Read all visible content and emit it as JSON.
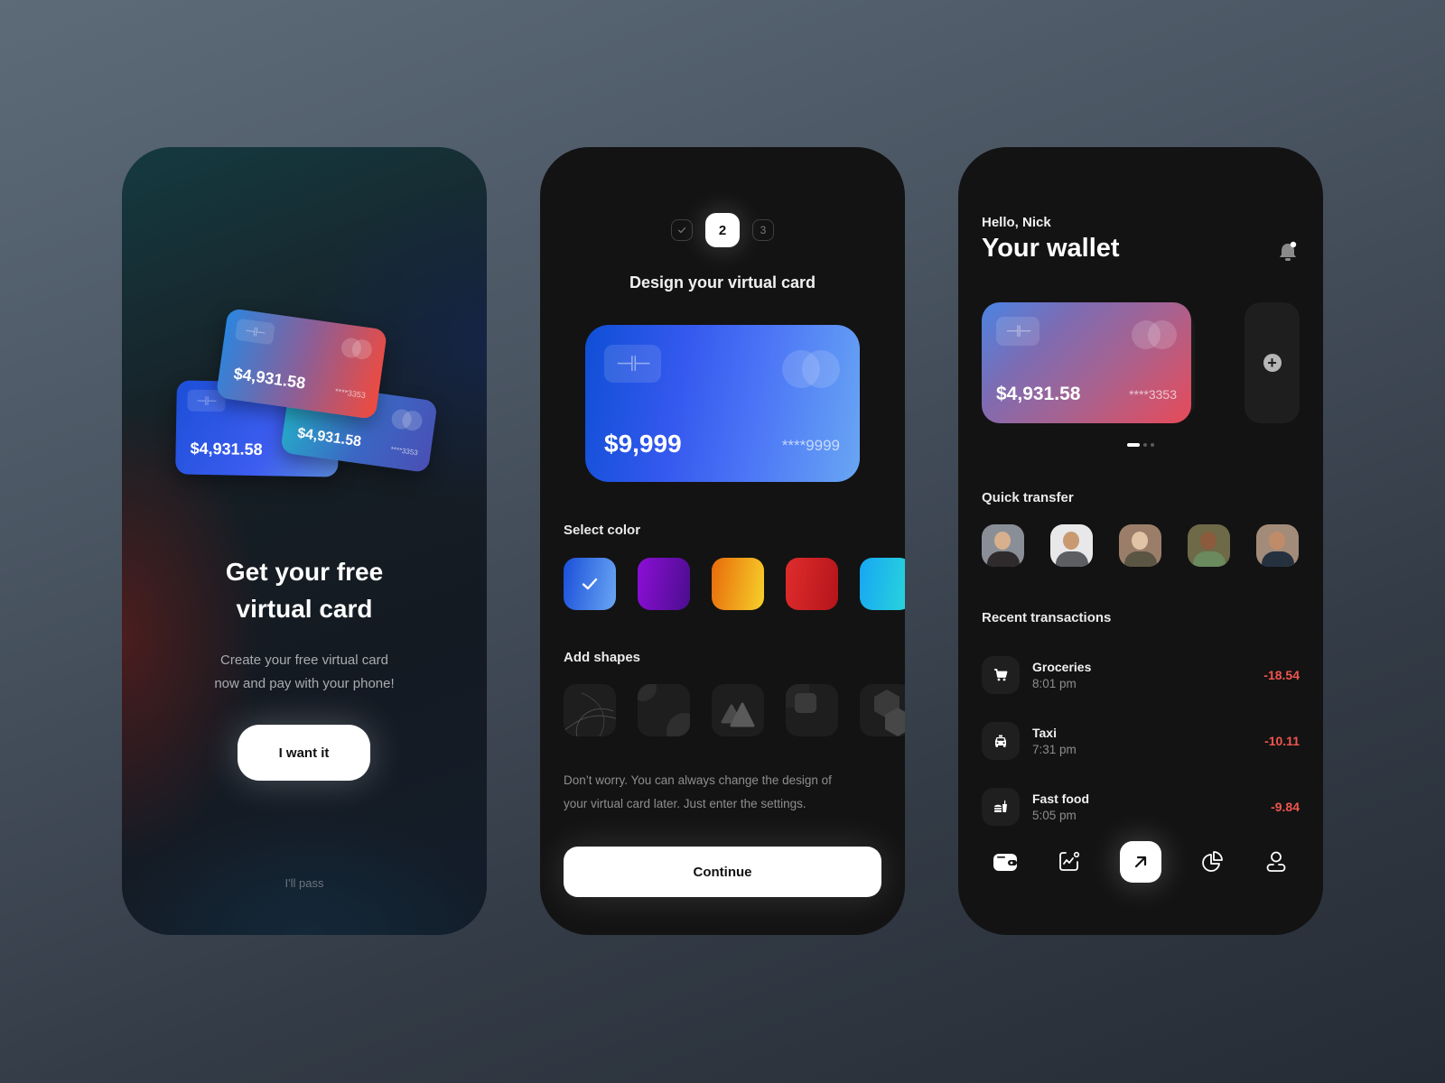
{
  "onboarding": {
    "cards": [
      {
        "amount": "$4,931.58",
        "number": "****3353"
      },
      {
        "amount": "$4,931.58",
        "number": "****3353"
      },
      {
        "amount": "$4,931.58",
        "number": ""
      }
    ],
    "title_line1": "Get your free",
    "title_line2": "virtual card",
    "subtitle_line1": "Create your free virtual card",
    "subtitle_line2": "now and pay with your phone!",
    "primary_button": "I want it",
    "secondary_link": "I'll pass"
  },
  "design": {
    "steps": [
      {
        "label": "✓",
        "state": "done"
      },
      {
        "label": "2",
        "state": "active"
      },
      {
        "label": "3",
        "state": "upcoming"
      }
    ],
    "title": "Design your virtual card",
    "card": {
      "amount": "$9,999",
      "number": "****9999",
      "chip_icon": "chip-icon",
      "logo_icon": "card-network-logo"
    },
    "select_color_label": "Select color",
    "colors": [
      {
        "name": "blue",
        "from": "#1a4fd9",
        "to": "#6aa6f4",
        "selected": true
      },
      {
        "name": "purple",
        "from": "#8c0fd6",
        "to": "#4b0d8e",
        "selected": false
      },
      {
        "name": "orange",
        "from": "#e86a0b",
        "to": "#f7d12a",
        "selected": false
      },
      {
        "name": "red",
        "from": "#e02c2c",
        "to": "#b3151b",
        "selected": false
      },
      {
        "name": "cyan",
        "from": "#17a6f3",
        "to": "#2ad9d9",
        "selected": false
      }
    ],
    "add_shapes_label": "Add shapes",
    "shapes": [
      "lines",
      "circles",
      "triangles",
      "squares",
      "hexagons"
    ],
    "note_line1": "Don’t worry. You can always change the design of",
    "note_line2": "your virtual card later. Just enter the settings.",
    "continue_button": "Continue"
  },
  "wallet": {
    "greeting": "Hello, Nick",
    "title": "Your wallet",
    "notification_icon": "bell-icon",
    "card": {
      "amount": "$4,931.58",
      "number": "****3353"
    },
    "add_card_icon": "plus-circle-icon",
    "carousel": {
      "count": 3,
      "active": 0
    },
    "quick_transfer_label": "Quick transfer",
    "contacts": [
      {
        "name": "contact-1",
        "bg": "#8a8e96",
        "skin": "#d8b08e",
        "shirt": "#2f2a2c"
      },
      {
        "name": "contact-2",
        "bg": "#e8e8ea",
        "skin": "#c99a72",
        "shirt": "#5d5e62"
      },
      {
        "name": "contact-3",
        "bg": "#9b7e6a",
        "skin": "#e1c3a6",
        "shirt": "#5b5543"
      },
      {
        "name": "contact-4",
        "bg": "#6e6a48",
        "skin": "#8c5a3c",
        "shirt": "#6b8a5e"
      },
      {
        "name": "contact-5",
        "bg": "#a38b7a",
        "skin": "#c08b68",
        "shirt": "#263140"
      }
    ],
    "recent_label": "Recent transactions",
    "transactions": [
      {
        "name": "Groceries",
        "time": "8:01 pm",
        "amount": "-18.54",
        "icon": "cart-icon"
      },
      {
        "name": "Taxi",
        "time": "7:31 pm",
        "amount": "-10.11",
        "icon": "taxi-icon"
      },
      {
        "name": "Fast food",
        "time": "5:05 pm",
        "amount": "-9.84",
        "icon": "fast-food-icon"
      }
    ],
    "tabbar": [
      "wallet-icon",
      "analytics-icon",
      "send-arrow-icon",
      "pie-chart-icon",
      "profile-icon"
    ],
    "negative_color": "#f0554e"
  }
}
